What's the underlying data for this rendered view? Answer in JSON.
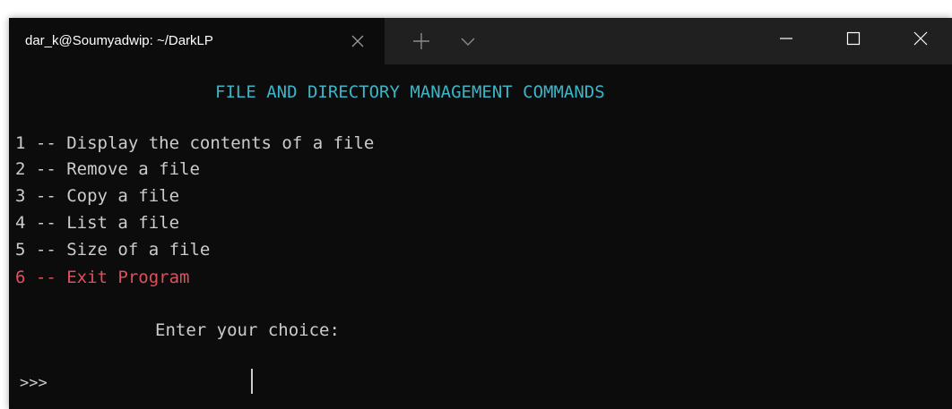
{
  "window": {
    "tab_title": "dar_k@Soumyadwip: ~/DarkLP",
    "icons": {
      "tab_close": "close-icon",
      "new_tab": "plus-icon",
      "dropdown": "chevron-down-icon",
      "minimize": "minimize-icon",
      "maximize": "maximize-icon",
      "close": "close-icon"
    }
  },
  "terminal": {
    "heading": "FILE AND DIRECTORY MANAGEMENT COMMANDS",
    "menu": [
      "1 -- Display the contents of a file",
      "2 -- Remove a file",
      "3 -- Copy a file",
      "4 -- List a file",
      "5 -- Size of a file",
      "6 -- Exit Program"
    ],
    "prompt_label": "Enter your choice:",
    "prompt_symbol": ">>>",
    "input_value": ""
  },
  "colors": {
    "background": "#0c0c0c",
    "titlebar": "#202020",
    "text": "#cccccc",
    "heading": "#3ab6c8",
    "exit_option": "#e0505c"
  }
}
